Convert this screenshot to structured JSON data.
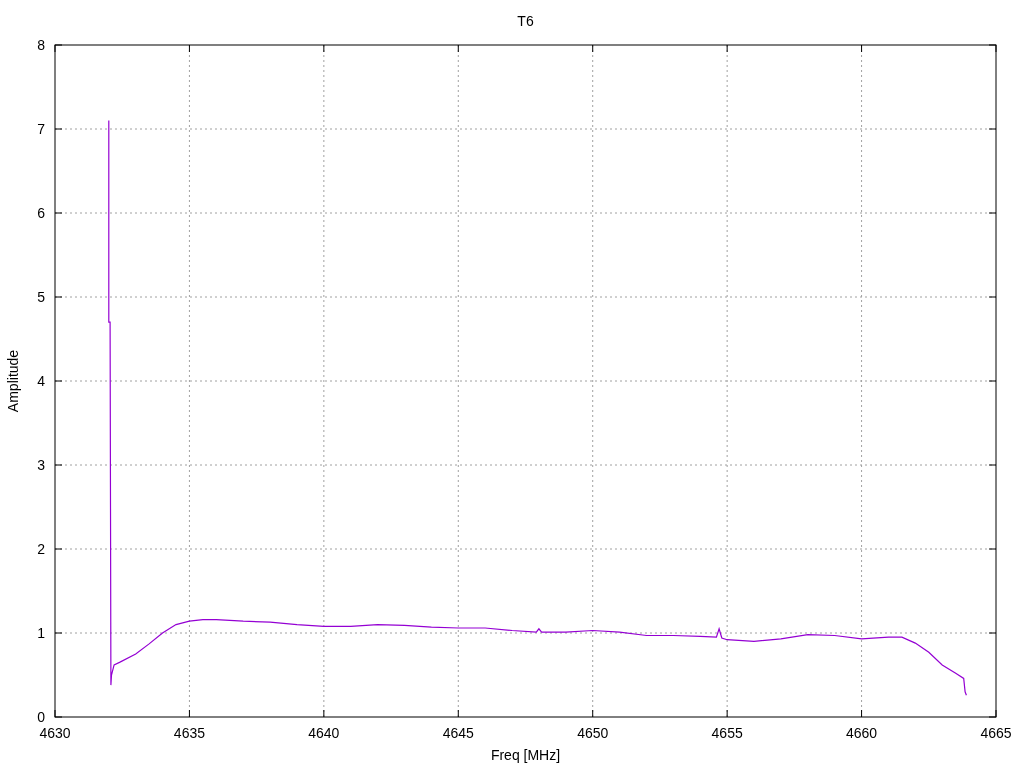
{
  "chart_data": {
    "type": "line",
    "title": "T6",
    "xlabel": "Freq [MHz]",
    "ylabel": "Amplitude",
    "x": [
      4632.0,
      4632.0,
      4632.05,
      4632.08,
      4632.1,
      4632.2,
      4632.4,
      4633,
      4633.5,
      4634,
      4634.5,
      4635,
      4635.5,
      4636,
      4637,
      4638,
      4639,
      4640,
      4641,
      4642,
      4643,
      4644,
      4645,
      4646,
      4647,
      4647.9,
      4648.0,
      4648.1,
      4649,
      4650,
      4651,
      4652,
      4653,
      4654,
      4654.6,
      4654.7,
      4654.8,
      4655,
      4656,
      4657,
      4658,
      4659,
      4660,
      4661,
      4661.5,
      4662,
      4662.5,
      4663,
      4663.5,
      4663.8,
      4663.85,
      4663.9
    ],
    "series": [
      {
        "color": "#9400d3",
        "values": [
          7.1,
          4.7,
          4.7,
          0.38,
          0.5,
          0.62,
          0.65,
          0.75,
          0.87,
          1.0,
          1.1,
          1.14,
          1.16,
          1.16,
          1.14,
          1.13,
          1.1,
          1.08,
          1.08,
          1.1,
          1.09,
          1.07,
          1.06,
          1.06,
          1.03,
          1.01,
          1.05,
          1.01,
          1.01,
          1.03,
          1.01,
          0.97,
          0.97,
          0.96,
          0.95,
          1.05,
          0.94,
          0.92,
          0.9,
          0.93,
          0.98,
          0.97,
          0.93,
          0.95,
          0.95,
          0.88,
          0.77,
          0.62,
          0.52,
          0.46,
          0.3,
          0.26
        ]
      }
    ],
    "grid": true,
    "xlim": [
      4630,
      4665
    ],
    "ylim": [
      0,
      8
    ],
    "xticks": [
      4630,
      4635,
      4640,
      4645,
      4650,
      4655,
      4660,
      4665
    ],
    "yticks": [
      0,
      1,
      2,
      3,
      4,
      5,
      6,
      7,
      8
    ]
  }
}
